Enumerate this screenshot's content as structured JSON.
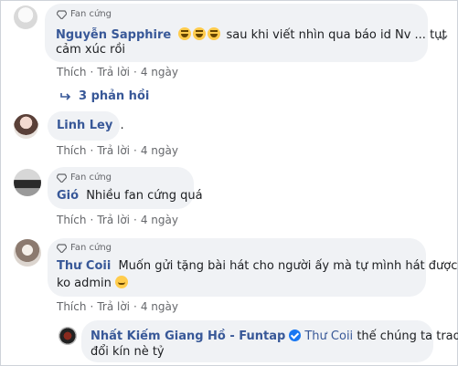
{
  "colors": {
    "bubble_bg": "#f0f2f5",
    "name_blue": "#385898",
    "meta_gray": "#65676b",
    "verified_blue": "#1877f2"
  },
  "fan_badge": "Fan cứng",
  "actions": {
    "like": "Thích",
    "reply": "Trả lời",
    "dot": "·"
  },
  "comments": [
    {
      "author": "Nguyễn Sapphire",
      "text_after_emojis": "sau khi viết nhìn qua báo id Nv ... tụt",
      "text_line2": "cảm xúc rồi",
      "emojis": [
        "laugh-emoji",
        "laugh-emoji",
        "laugh-emoji"
      ],
      "time": "4 ngày",
      "replies_label": "3 phản hồi"
    },
    {
      "author": "Linh Ley",
      "text": ".",
      "time": "4 ngày"
    },
    {
      "author": "Gió",
      "text": "Nhiều fan cứng quá",
      "time": "4 ngày"
    },
    {
      "author": "Thư Coii",
      "text": "Muốn gửi tặng bài hát cho người ấy mà tự mình hát được",
      "text_line2": "ko admin",
      "emojis": [
        "smile-emoji"
      ],
      "time": "4 ngày"
    }
  ],
  "reply": {
    "author": "Nhất Kiếm Giang Hồ - Funtap",
    "mention": "Thư Coii",
    "text": "thế chúng ta trao",
    "text_line2": "đổi kín nè tỷ"
  }
}
